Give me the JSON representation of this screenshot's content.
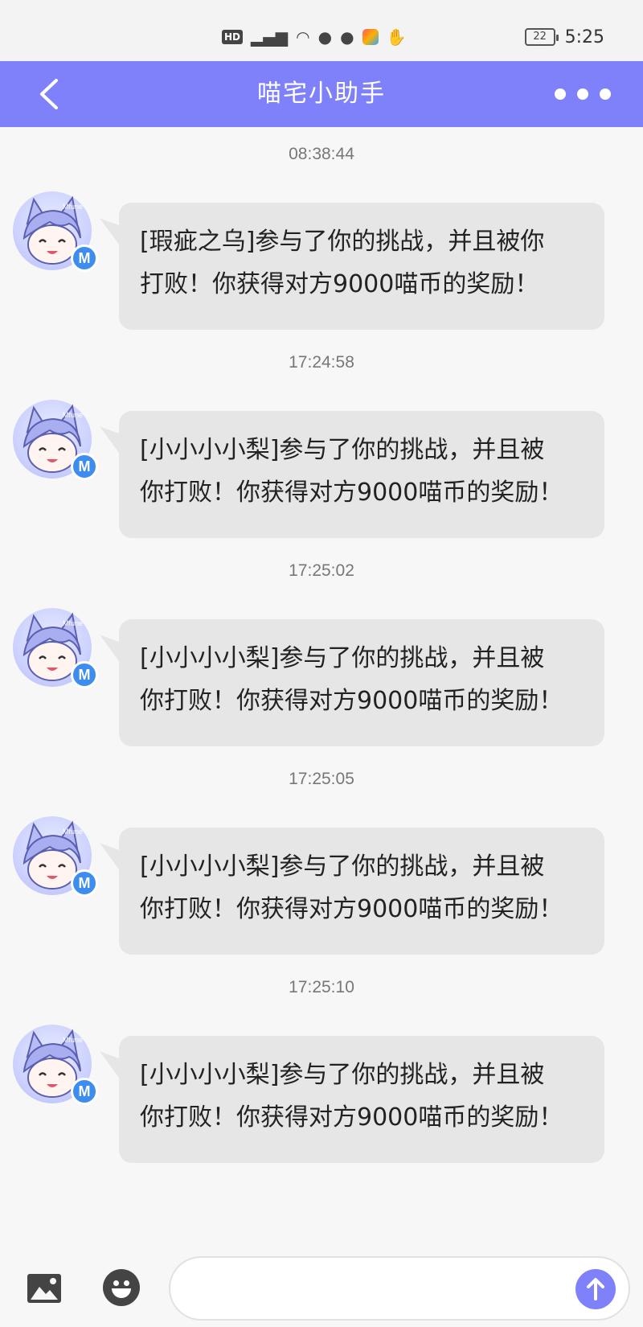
{
  "status_bar": {
    "hd_label": "HD",
    "time": "5:25",
    "battery": "22",
    "icons": [
      "signal-5g-icon",
      "wifi-icon",
      "wechat-icon",
      "message-icon",
      "app-icon",
      "hand-icon"
    ]
  },
  "header": {
    "title": "喵宅小助手",
    "back_icon": "chevron-left-icon",
    "more_icon": "more-dots-icon",
    "background": "#7f81fb"
  },
  "messages": [
    {
      "time": "08:38:44",
      "line1": "[瑕疵之乌]参与了你的挑战，并且被你",
      "line2": "打败！你获得对方9000喵币的奖励！"
    },
    {
      "time": "17:24:58",
      "line1": "[小小小小梨]参与了你的挑战，并且被",
      "line2": "你打败！你获得对方9000喵币的奖励！"
    },
    {
      "time": "17:25:02",
      "line1": "[小小小小梨]参与了你的挑战，并且被",
      "line2": "你打败！你获得对方9000喵币的奖励！"
    },
    {
      "time": "17:25:05",
      "line1": "[小小小小梨]参与了你的挑战，并且被",
      "line2": "你打败！你获得对方9000喵币的奖励！"
    },
    {
      "time": "17:25:10",
      "line1": "[小小小小梨]参与了你的挑战，并且被",
      "line2": "你打败！你获得对方9000喵币的奖励！"
    }
  ],
  "avatar_badge": "M",
  "input_bar": {
    "placeholder": "",
    "image_icon": "image-icon",
    "emoji_icon": "emoji-icon",
    "send_icon": "send-arrow-icon"
  }
}
